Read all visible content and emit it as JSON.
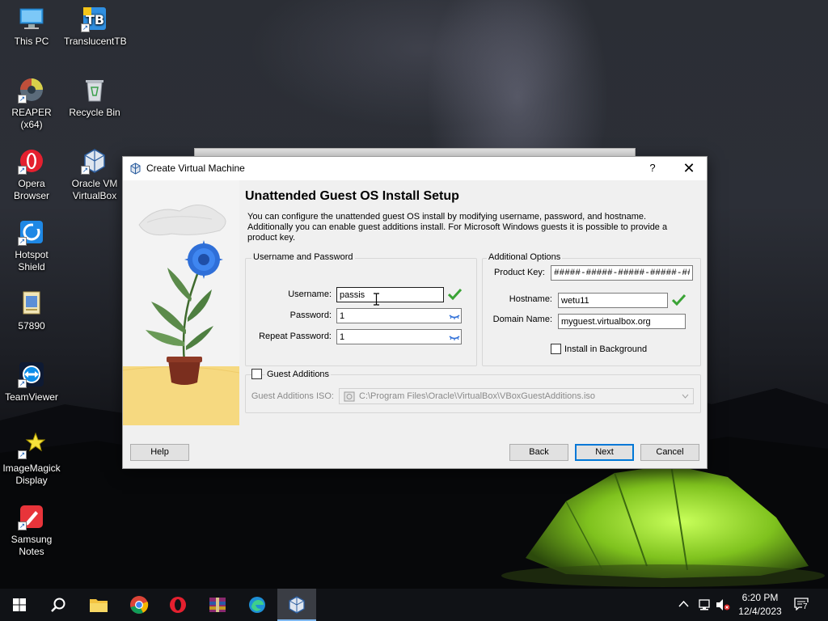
{
  "desktop": {
    "icons": [
      {
        "label": "This PC"
      },
      {
        "label": "TranslucentTB"
      },
      {
        "label": "REAPER (x64)"
      },
      {
        "label": "Recycle Bin"
      },
      {
        "label": "Opera Browser"
      },
      {
        "label": "Oracle VM VirtualBox"
      },
      {
        "label": "Hotspot Shield"
      },
      {
        "label": "57890"
      },
      {
        "label": "TeamViewer"
      },
      {
        "label": "ImageMagick Display"
      },
      {
        "label": "Samsung Notes"
      }
    ]
  },
  "dialog": {
    "title": "Create Virtual Machine",
    "help_glyph": "?",
    "close_glyph": "✕",
    "heading": "Unattended Guest OS Install Setup",
    "description": "You can configure the unattended guest OS install by modifying username, password, and hostname. Additionally you can enable guest additions install. For Microsoft Windows guests it is possible to provide a product key.",
    "user_group": {
      "title": "Username and Password",
      "username_label": "Username:",
      "username_value": "passis",
      "password_label": "Password:",
      "password_value": "1",
      "repeat_label": "Repeat Password:",
      "repeat_value": "1"
    },
    "options_group": {
      "title": "Additional Options",
      "product_key_label": "Product Key:",
      "product_key_value": "#####-#####-#####-#####-#####",
      "hostname_label": "Hostname:",
      "hostname_value": "wetu11",
      "domain_label": "Domain Name:",
      "domain_value": "myguest.virtualbox.org",
      "install_bg_label": "Install in Background",
      "install_bg_checked": false
    },
    "guest_additions": {
      "label": "Guest Additions",
      "checked": false,
      "iso_label": "Guest Additions ISO:",
      "iso_value": "C:\\Program Files\\Oracle\\VirtualBox\\VBoxGuestAdditions.iso"
    },
    "buttons": {
      "help": "Help",
      "back": "Back",
      "next": "Next",
      "cancel": "Cancel"
    }
  },
  "taskbar": {
    "apps": [
      "start",
      "search",
      "file-explorer",
      "chrome",
      "opera",
      "winrar",
      "edge",
      "virtualbox"
    ],
    "time": "6:20 PM",
    "date": "12/4/2023",
    "notification_count": "7"
  },
  "colors": {
    "accent": "#0078d7",
    "valid_check": "#3aa335",
    "dialog_bg": "#f0f0f0"
  }
}
